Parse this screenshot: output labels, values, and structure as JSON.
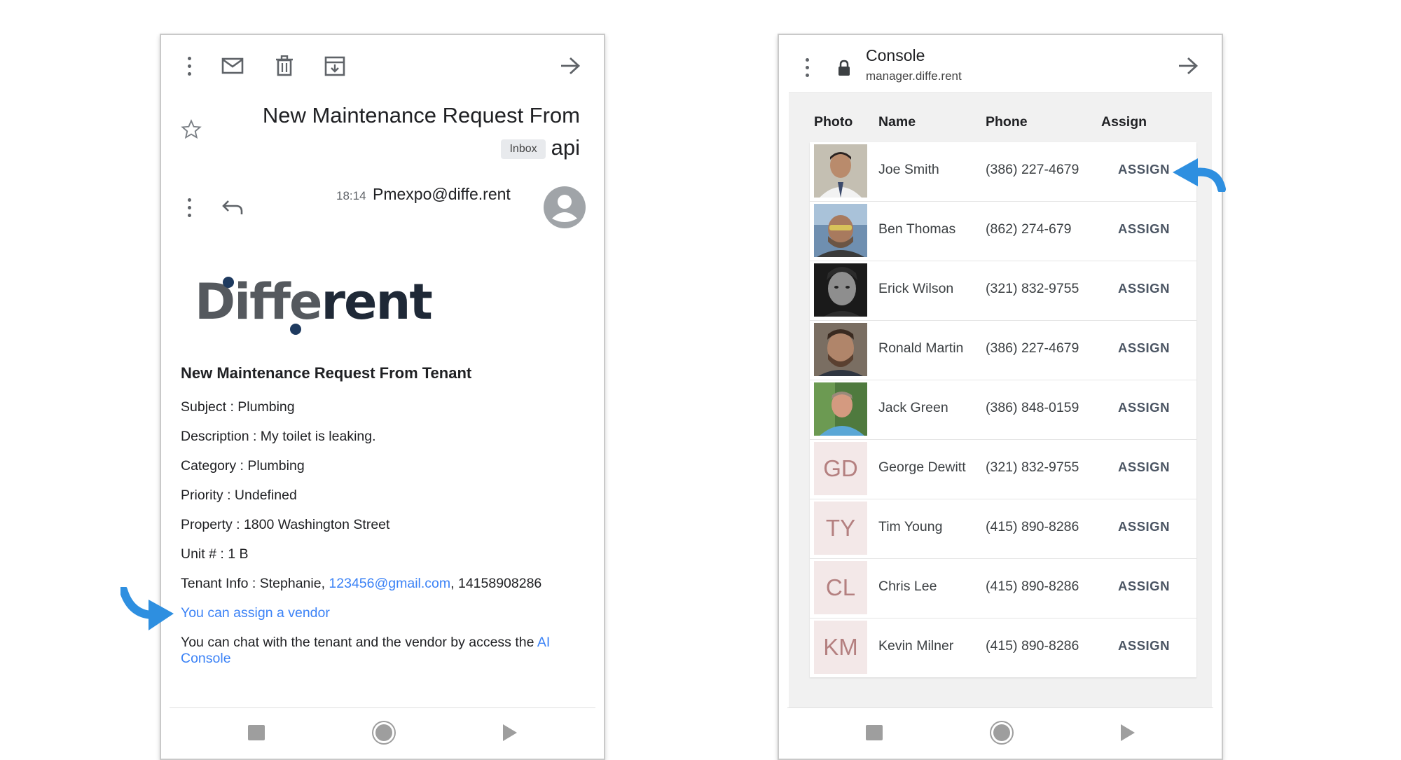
{
  "colors": {
    "accent_link": "#3b82f6",
    "arrow": "#2e8fe0",
    "logo_dot": "#1e3a5f"
  },
  "email": {
    "title_line1": "New Maintenance Request From",
    "title_line2": "api",
    "inbox_badge": "Inbox",
    "time": "18:14",
    "sender": "Pmexpo@diffe.rent",
    "logo_part1": "Diffe",
    "logo_part2": "rent",
    "heading": "New Maintenance Request From Tenant",
    "lines": {
      "subject": "Subject : Plumbing",
      "description": "Description : My toilet is leaking.",
      "category": "Category : Plumbing",
      "priority": "Priority : Undefined",
      "property": "Property : 1800 Washington Street",
      "unit": "Unit # : 1 B"
    },
    "tenant_info_prefix": "Tenant Info : Stephanie, ",
    "tenant_email": "123456@gmail.com",
    "tenant_info_suffix": ", 14158908286",
    "assign_link": "You can assign a vendor",
    "chat_text": "You can chat with the tenant and the vendor by access the ",
    "chat_link": "AI Console",
    "icons": [
      "more-vert-icon",
      "mail-icon",
      "trash-icon",
      "archive-icon",
      "forward-arrow-icon",
      "star-icon",
      "reply-icon",
      "avatar-icon"
    ]
  },
  "console": {
    "title": "Console",
    "url": "manager.diffe.rent",
    "columns": {
      "photo": "Photo",
      "name": "Name",
      "phone": "Phone",
      "assign": "Assign"
    },
    "rows": [
      {
        "name": "Joe Smith",
        "phone": "(386) 227-4679",
        "action": "ASSIGN"
      },
      {
        "name": "Ben Thomas",
        "phone": "(862) 274-679",
        "action": "ASSIGN"
      },
      {
        "name": "Erick Wilson",
        "phone": "(321) 832-9755",
        "action": "ASSIGN"
      },
      {
        "name": "Ronald Martin",
        "phone": "(386) 227-4679",
        "action": "ASSIGN"
      },
      {
        "name": "Jack Green",
        "phone": "(386) 848-0159",
        "action": "ASSIGN"
      },
      {
        "name": "George Dewitt",
        "phone": "(321) 832-9755",
        "action": "ASSIGN",
        "initials": "GD"
      },
      {
        "name": "Tim Young",
        "phone": "(415) 890-8286",
        "action": "ASSIGN",
        "initials": "TY"
      },
      {
        "name": "Chris Lee",
        "phone": "(415) 890-8286",
        "action": "ASSIGN",
        "initials": "CL"
      },
      {
        "name": "Kevin Milner",
        "phone": "(415) 890-8286",
        "action": "ASSIGN",
        "initials": "KM"
      }
    ]
  }
}
